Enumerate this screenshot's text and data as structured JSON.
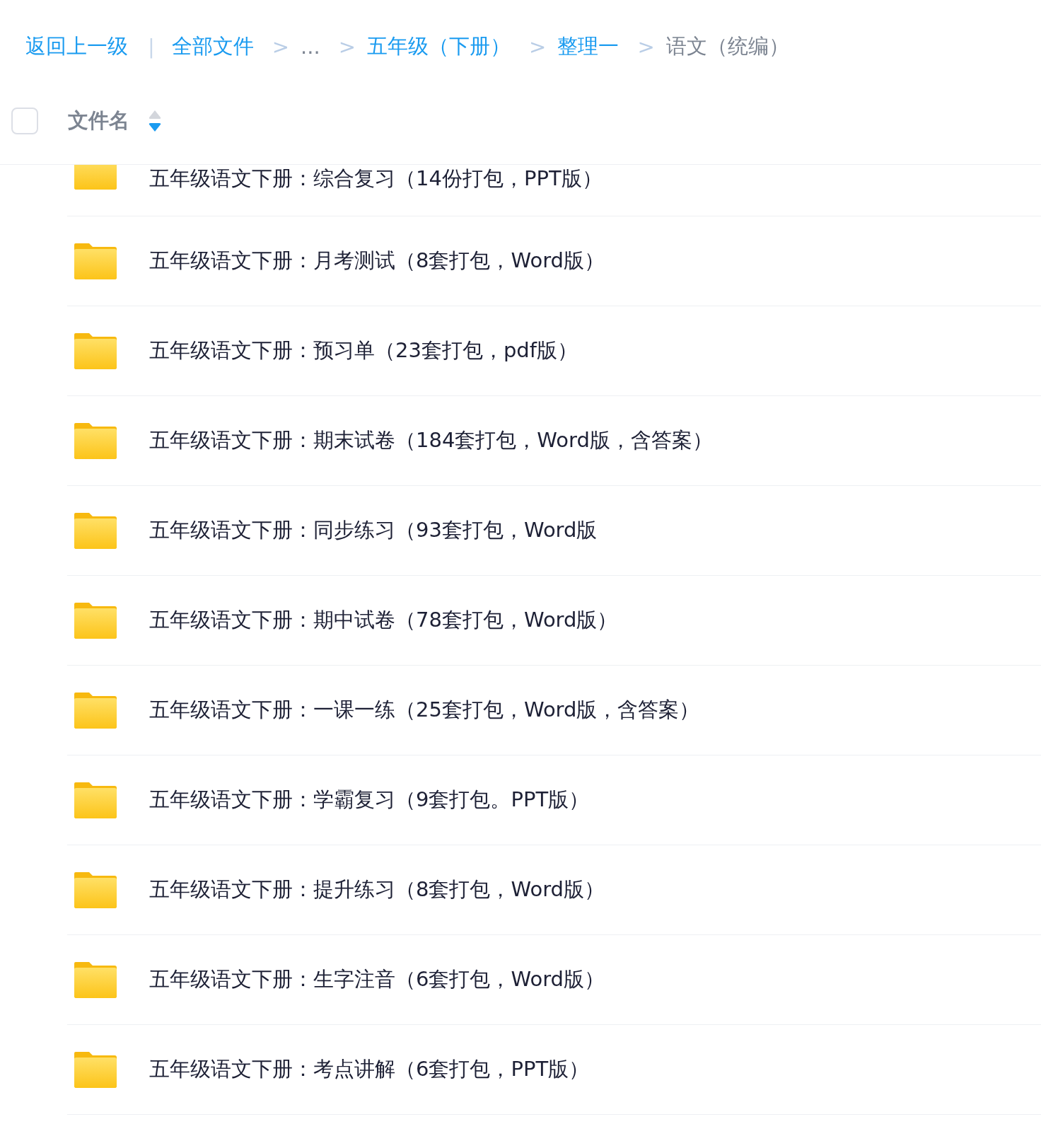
{
  "breadcrumb": [
    {
      "kind": "link",
      "label": "返回上一级"
    },
    {
      "kind": "divider",
      "label": "|"
    },
    {
      "kind": "link",
      "label": "全部文件"
    },
    {
      "kind": "separator",
      "label": ">"
    },
    {
      "kind": "ellipsis",
      "label": "..."
    },
    {
      "kind": "separator",
      "label": ">"
    },
    {
      "kind": "link",
      "label": "五年级（下册）"
    },
    {
      "kind": "separator",
      "label": ">"
    },
    {
      "kind": "link",
      "label": "整理一"
    },
    {
      "kind": "separator",
      "label": ">"
    },
    {
      "kind": "current",
      "label": "语文（统编）"
    }
  ],
  "header": {
    "select_all": {
      "checked": false
    },
    "column": "文件名",
    "sort_descending": true
  },
  "files": [
    {
      "name": "五年级语文下册：综合复习（14份打包，PPT版）"
    },
    {
      "name": "五年级语文下册：月考测试（8套打包，Word版）"
    },
    {
      "name": "五年级语文下册：预习单（23套打包，pdf版）"
    },
    {
      "name": "五年级语文下册：期末试卷（184套打包，Word版，含答案）"
    },
    {
      "name": "五年级语文下册：同步练习（93套打包，Word版"
    },
    {
      "name": "五年级语文下册：期中试卷（78套打包，Word版）"
    },
    {
      "name": "五年级语文下册：一课一练（25套打包，Word版，含答案）"
    },
    {
      "name": "五年级语文下册：学霸复习（9套打包。PPT版）"
    },
    {
      "name": "五年级语文下册：提升练习（8套打包，Word版）"
    },
    {
      "name": "五年级语文下册：生字注音（6套打包，Word版）"
    },
    {
      "name": "五年级语文下册：考点讲解（6套打包，PPT版）"
    }
  ]
}
